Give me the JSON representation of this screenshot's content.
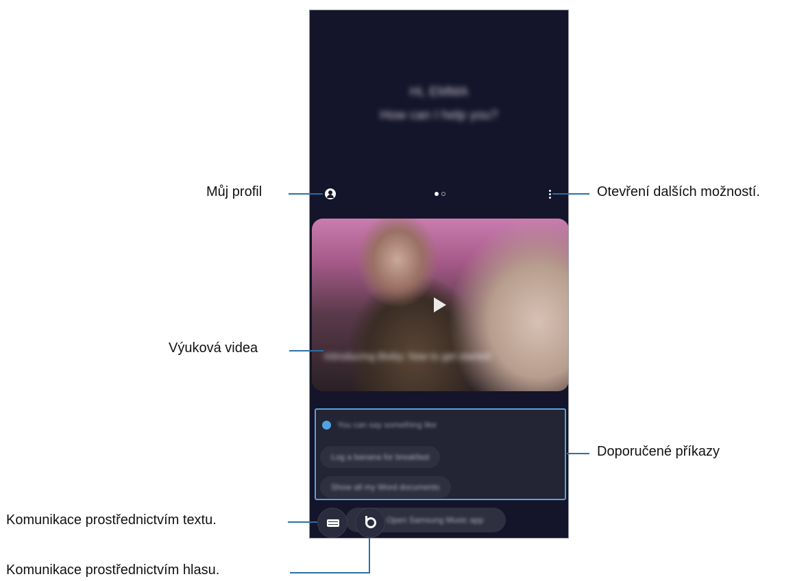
{
  "screen": {
    "greeting": [
      "Hi, EMMA",
      "How can I help you?"
    ],
    "page_dots": {
      "count": 2,
      "active": 0
    },
    "video_caption": "Introducing Bixby: how to get started",
    "suggestions": {
      "hint": "You can say something like",
      "chips": [
        "Log a banana for breakfast",
        "Show all my Word documents"
      ],
      "bottom_chip": "Open Samsung Music app"
    }
  },
  "annotations": {
    "profile": "Můj profil",
    "more_options": "Otevření dalších možností.",
    "tutorial_videos": "Výuková videa",
    "suggested_commands": "Doporučené příkazy",
    "text_communication": "Komunikace prostřednictvím textu.",
    "voice_communication": "Komunikace prostřednictvím hlasu."
  },
  "colors": {
    "screen_background": "#14142a",
    "highlight_border": "#55a6d9",
    "callout_line": "#2a6fa5"
  },
  "icons": [
    "profile-icon",
    "more-options-icon",
    "play-icon",
    "bixby-suggestion-icon",
    "keyboard-icon",
    "bixby-voice-icon"
  ]
}
